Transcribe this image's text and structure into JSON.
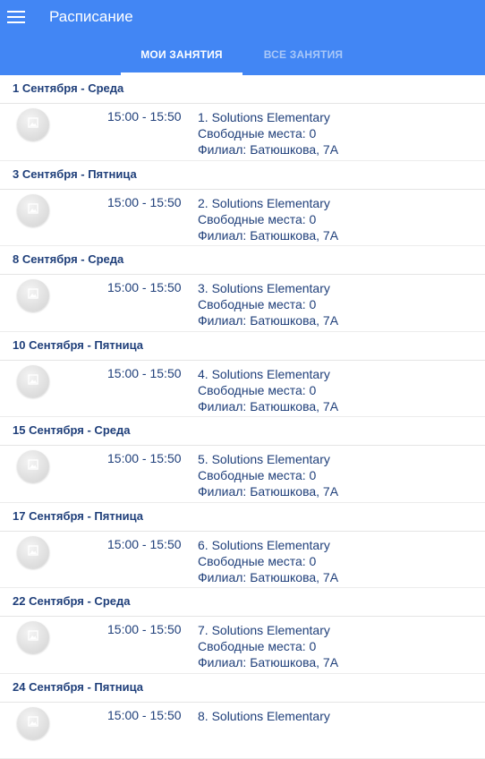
{
  "appbar": {
    "title": "Расписание",
    "menu_icon": "hamburger-menu-icon",
    "color": "#4286f4"
  },
  "tabs": [
    {
      "label": "МОИ ЗАНЯТИЯ",
      "active": true
    },
    {
      "label": "ВСЕ ЗАНЯТИЯ",
      "active": false
    }
  ],
  "lessons": [
    {
      "date": "1 Сентября - Среда",
      "time": "15:00 - 15:50",
      "title": "1. Solutions Elementary",
      "seats": "Свободные места: 0",
      "branch": "Филиал: Батюшкова, 7А"
    },
    {
      "date": "3 Сентября - Пятница",
      "time": "15:00 - 15:50",
      "title": "2. Solutions Elementary",
      "seats": "Свободные места: 0",
      "branch": "Филиал: Батюшкова, 7А"
    },
    {
      "date": "8 Сентября - Среда",
      "time": "15:00 - 15:50",
      "title": "3. Solutions Elementary",
      "seats": "Свободные места: 0",
      "branch": "Филиал: Батюшкова, 7А"
    },
    {
      "date": "10 Сентября - Пятница",
      "time": "15:00 - 15:50",
      "title": "4. Solutions Elementary",
      "seats": "Свободные места: 0",
      "branch": "Филиал: Батюшкова, 7А"
    },
    {
      "date": "15 Сентября - Среда",
      "time": "15:00 - 15:50",
      "title": "5. Solutions Elementary",
      "seats": "Свободные места: 0",
      "branch": "Филиал: Батюшкова, 7А"
    },
    {
      "date": "17 Сентября - Пятница",
      "time": "15:00 - 15:50",
      "title": "6. Solutions Elementary",
      "seats": "Свободные места: 0",
      "branch": "Филиал: Батюшкова, 7А"
    },
    {
      "date": "22 Сентября - Среда",
      "time": "15:00 - 15:50",
      "title": "7. Solutions Elementary",
      "seats": "Свободные места: 0",
      "branch": "Филиал: Батюшкова, 7А"
    },
    {
      "date": "24 Сентября - Пятница",
      "time": "15:00 - 15:50",
      "title": "8. Solutions Elementary",
      "seats": "",
      "branch": ""
    }
  ]
}
